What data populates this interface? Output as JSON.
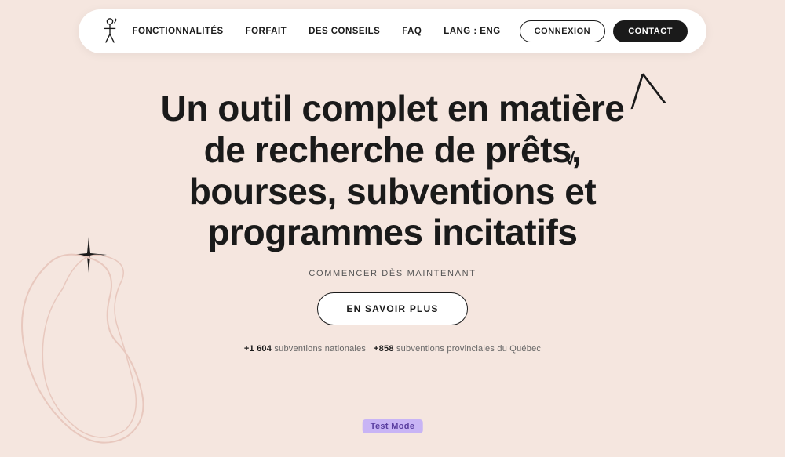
{
  "nav": {
    "links": [
      {
        "label": "FONCTIONNALITÉS",
        "id": "fonctionnalites"
      },
      {
        "label": "FORFAIT",
        "id": "forfait"
      },
      {
        "label": "DES CONSEILS",
        "id": "des-conseils"
      },
      {
        "label": "FAQ",
        "id": "faq"
      },
      {
        "label": "LANG : ENG",
        "id": "lang"
      }
    ],
    "btn_connexion": "CONNEXION",
    "btn_contact": "CONTACT"
  },
  "hero": {
    "title_line1": "Un outil complet en matière",
    "title_line2": "de recherche de prêts,",
    "title_line3": "bourses, subventions et",
    "title_line4": "programmes incitatifs",
    "subtitle": "COMMENCER DÈS MAINTENANT",
    "cta_label": "EN SAVOIR PLUS",
    "stats": {
      "national_count": "+1 604",
      "national_label": "subventions nationales",
      "provincial_count": "+858",
      "provincial_label": "subventions provinciales du Québec"
    }
  },
  "test_mode": {
    "label": "Test Mode"
  }
}
